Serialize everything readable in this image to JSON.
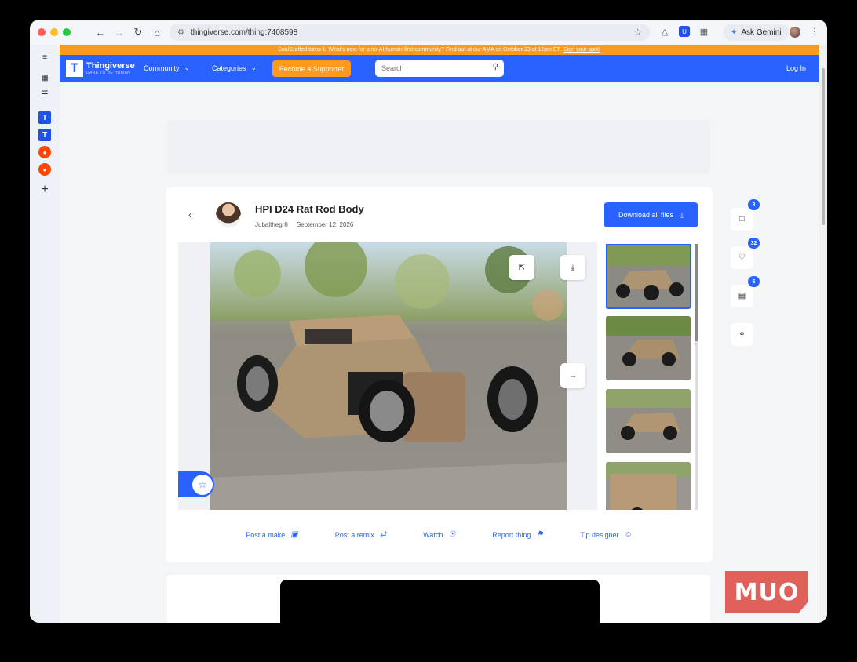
{
  "browser": {
    "url": "thingiverse.com/thing:7408598",
    "gemini_label": "Ask Gemini",
    "traffic_colors": [
      "#ff5f57",
      "#febc2e",
      "#28c840"
    ]
  },
  "banner": {
    "text": "SoalCrafted turns 1: What's next for a no-AI human-first community? Find out at our AMA on October 23 at 12pm ET.",
    "link": "Sign your spot!"
  },
  "nav": {
    "brand": "Thingiverse",
    "tagline": "DARE TO BE HUMAN",
    "community": "Community",
    "categories": "Categories",
    "supporter": "Become a Supporter",
    "search_placeholder": "Search",
    "login": "Log In"
  },
  "thing": {
    "title": "HPI D24 Rat Rod Body",
    "author": "Jubalthegr8",
    "date": "September 12, 2026",
    "download_label": "Download all files"
  },
  "actions": {
    "post_make": "Post a make",
    "post_remix": "Post a remix",
    "watch": "Watch",
    "report": "Report thing",
    "tip": "Tip designer"
  },
  "counts": {
    "comments": "3",
    "likes": "32",
    "collections": "6"
  },
  "watermark": "MUO",
  "colors": {
    "accent": "#2a62ff",
    "orange": "#ff9a1f"
  }
}
